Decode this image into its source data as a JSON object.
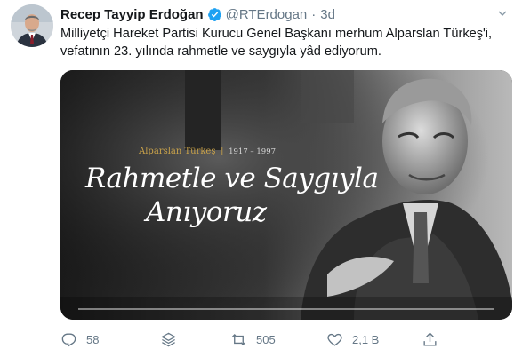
{
  "author": {
    "name": "Recep Tayyip Erdoğan",
    "handle": "@RTErdogan",
    "separator": "·",
    "time": "3d"
  },
  "tweet_text": {
    "line1": "Milliyetçi Hareket Partisi Kurucu Genel Başkanı merhum Alparslan Türkeş'i,",
    "line2": "vefatının 23. yılında rahmetle ve saygıyla yâd ediyorum."
  },
  "media": {
    "caption_name": "Alparslan Türkeş",
    "caption_separator": "|",
    "caption_years": "1917 – 1997",
    "script_line1": "Rahmetle ve Saygıyla",
    "script_line2": "Anıyoruz"
  },
  "actions": {
    "reply_count": "58",
    "retweet_count": "505",
    "like_count": "2,1 B"
  },
  "icons": [
    "verified-badge-icon",
    "more-icon",
    "reply-icon",
    "stack-icon",
    "retweet-icon",
    "like-icon",
    "share-icon"
  ],
  "colors": {
    "verified": "#1da1f2",
    "gold": "#c9a24a",
    "muted": "#657786"
  }
}
